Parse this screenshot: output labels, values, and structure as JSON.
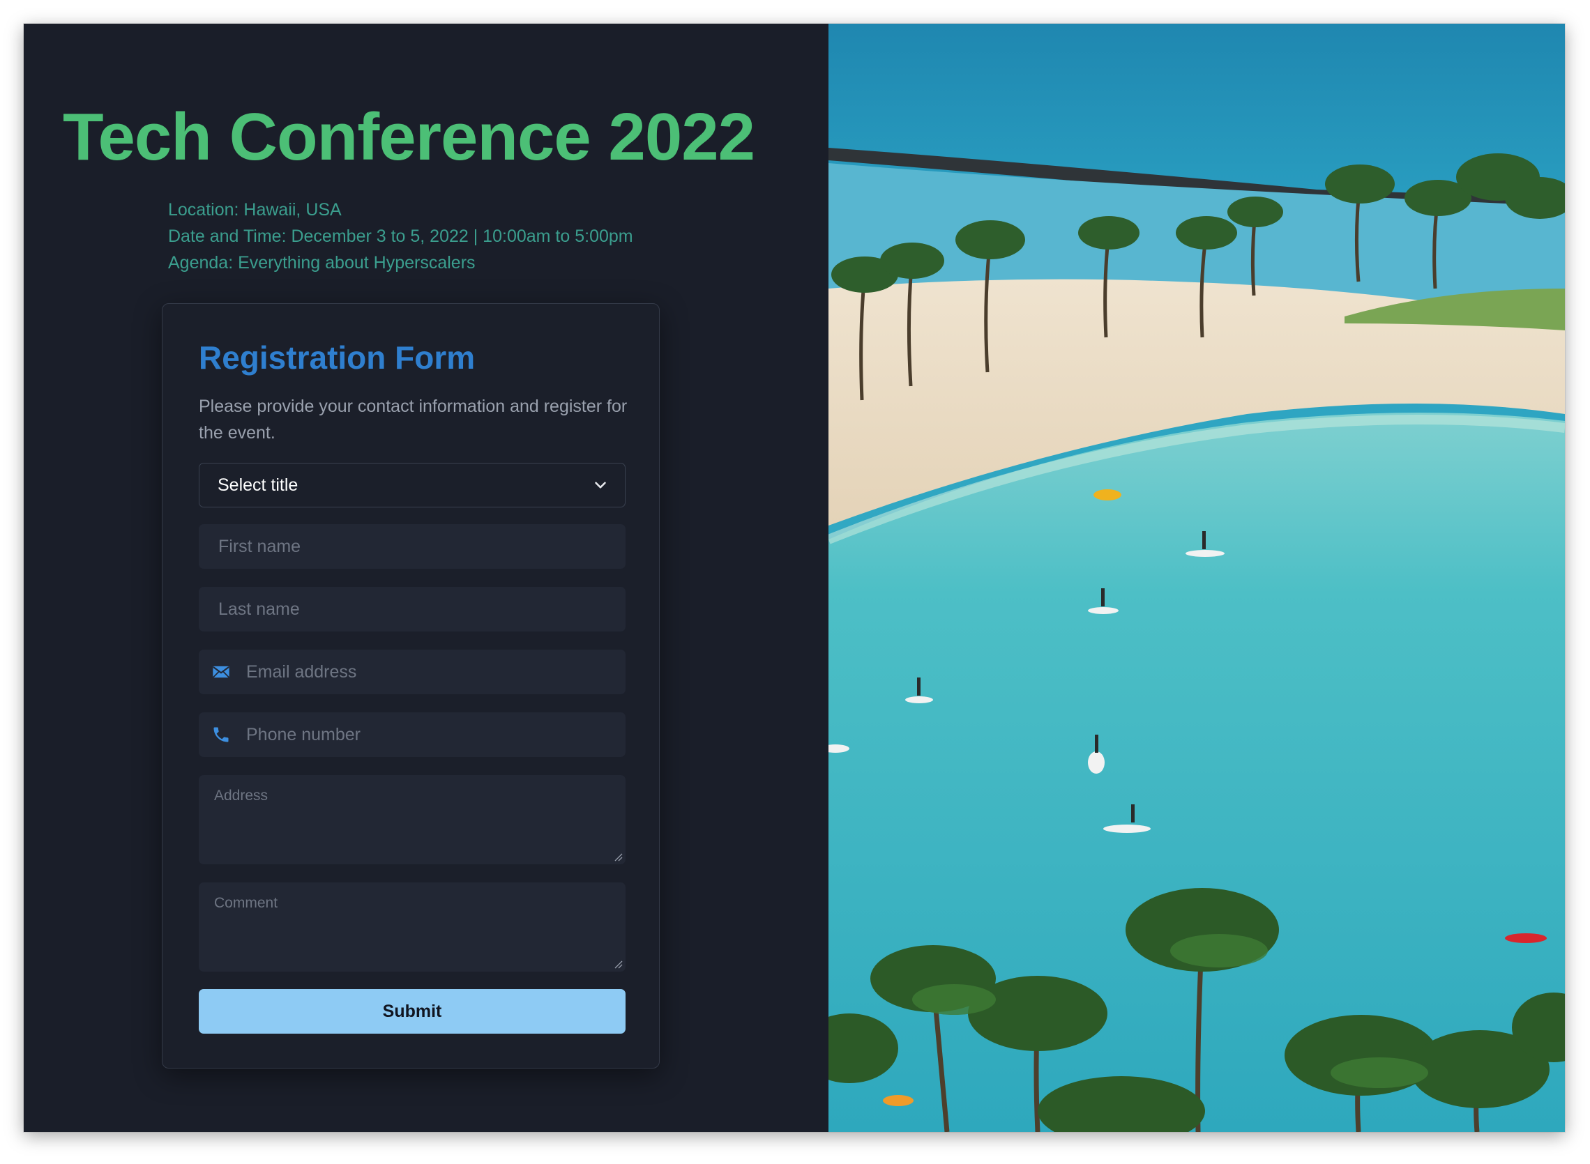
{
  "event": {
    "title": "Tech Conference 2022",
    "location": "Location: Hawaii, USA",
    "datetime": "Date and Time: December 3 to 5, 2022 | 10:00am to 5:00pm",
    "agenda": "Agenda: Everything about Hyperscalers"
  },
  "form": {
    "heading": "Registration Form",
    "description": "Please provide your contact information and register for the event.",
    "title_select": {
      "selected": "Select title"
    },
    "first_name": {
      "placeholder": "First name"
    },
    "last_name": {
      "placeholder": "Last name"
    },
    "email": {
      "placeholder": "Email address",
      "icon": "mail-icon"
    },
    "phone": {
      "placeholder": "Phone number",
      "icon": "phone-icon"
    },
    "address": {
      "placeholder": "Address"
    },
    "comment": {
      "placeholder": "Comment"
    },
    "submit_label": "Submit"
  },
  "colors": {
    "background": "#1a1e29",
    "title": "#4cbf76",
    "info_text": "#3b9e8e",
    "heading": "#2f7fcf",
    "submit_bg": "#8ecbf4",
    "field_bg": "#222734"
  },
  "image": {
    "subject": "aerial-beach-photo"
  }
}
